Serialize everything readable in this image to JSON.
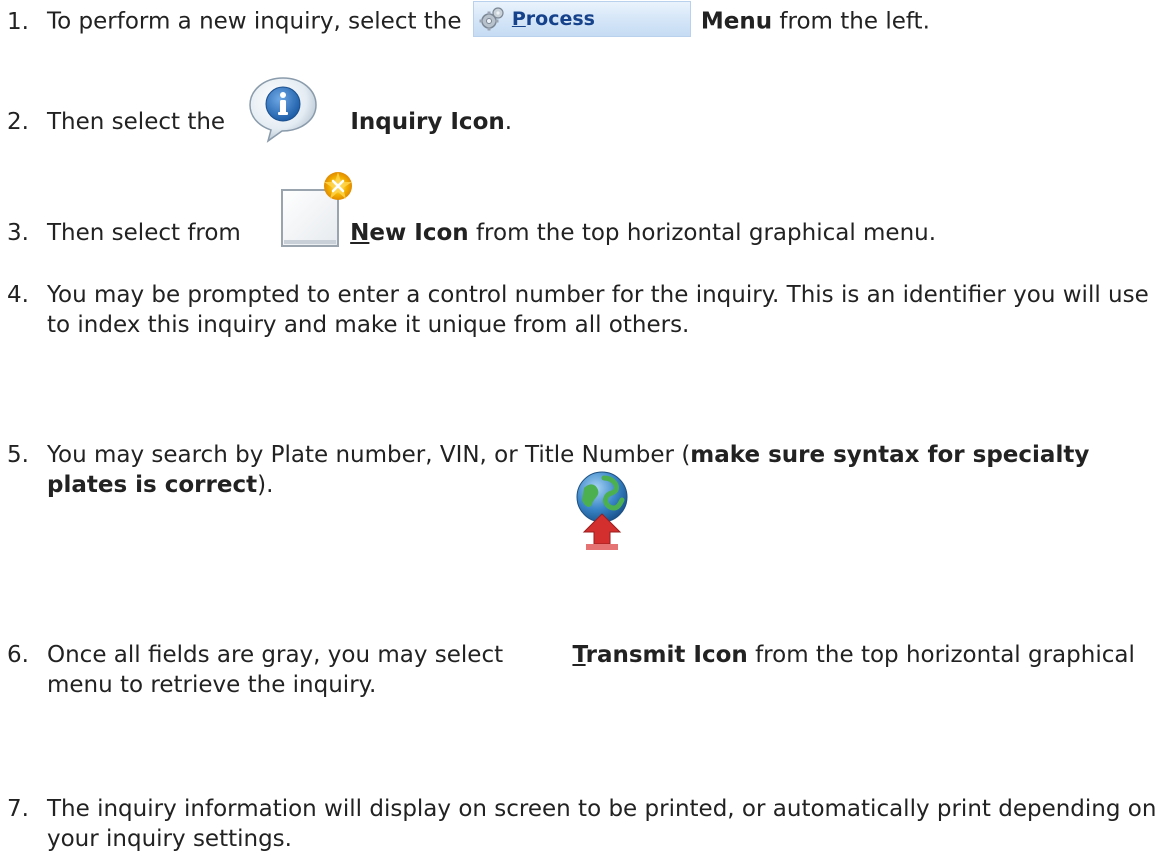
{
  "steps": [
    {
      "num": "1.",
      "pre": "To perform a new inquiry, select the",
      "button_label_first": "P",
      "button_label_rest": "rocess",
      "bold": "Menu",
      "post": " from the left."
    },
    {
      "num": "2.",
      "pre": "Then select the",
      "bold": "Inquiry Icon",
      "post": "."
    },
    {
      "num": "3.",
      "pre": "Then select from",
      "bold_underlined": "N",
      "bold": "ew Icon",
      "post": " from the top horizontal graphical menu."
    },
    {
      "num": "4.",
      "text": "You may be prompted to enter a control number for the inquiry. This is an identifier you will use to index this inquiry and make it unique from all others."
    },
    {
      "num": "5.",
      "pre": "You may search by Plate number, VIN, or Title Number (",
      "bold": "make sure syntax for specialty plates is correct",
      "post": ")."
    },
    {
      "num": "6.",
      "pre": "Once all fields are gray, you may select",
      "bold_underlined": "T",
      "bold": "ransmit Icon",
      "post": " from the top horizontal graphical menu to retrieve the inquiry."
    },
    {
      "num": "7.",
      "text": "The inquiry information will display on screen to be printed, or automatically print depending on your inquiry settings."
    }
  ],
  "icons": {
    "process": "gear-icon",
    "inquiry": "info-speech-bubble-icon",
    "new": "new-document-icon",
    "transmit": "globe-transmit-icon"
  },
  "colors": {
    "text": "#222222",
    "process_button_bg": "#d5e6f8",
    "process_label": "#15428b",
    "inquiry_icon_blue": "#2e6fb5",
    "new_icon_star": "#f4b400",
    "transmit_globe": "#3a86c8",
    "transmit_arrow": "#d32f2f"
  }
}
